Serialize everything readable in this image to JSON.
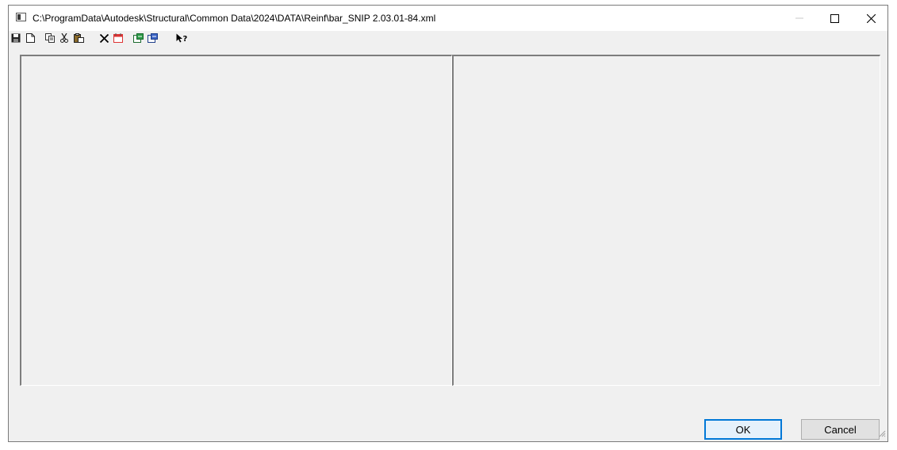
{
  "window": {
    "title": "C:\\ProgramData\\Autodesk\\Structural\\Common Data\\2024\\DATA\\Reinf\\bar_SNIP 2.03.01-84.xml",
    "controls": [
      "minimize-icon",
      "maximize-icon",
      "close-icon"
    ]
  },
  "toolbar": {
    "icons": [
      "save-icon",
      "new-icon",
      "copy-icon",
      "cut-icon",
      "paste-icon",
      "delete-icon",
      "calendar-icon",
      "import-icon",
      "export-icon",
      "context-help-icon"
    ]
  },
  "buttons": {
    "ok_label": "OK",
    "cancel_label": "Cancel"
  },
  "colors": {
    "dialog_bg": "#f0f0f0",
    "default_button_border": "#0078d7"
  }
}
